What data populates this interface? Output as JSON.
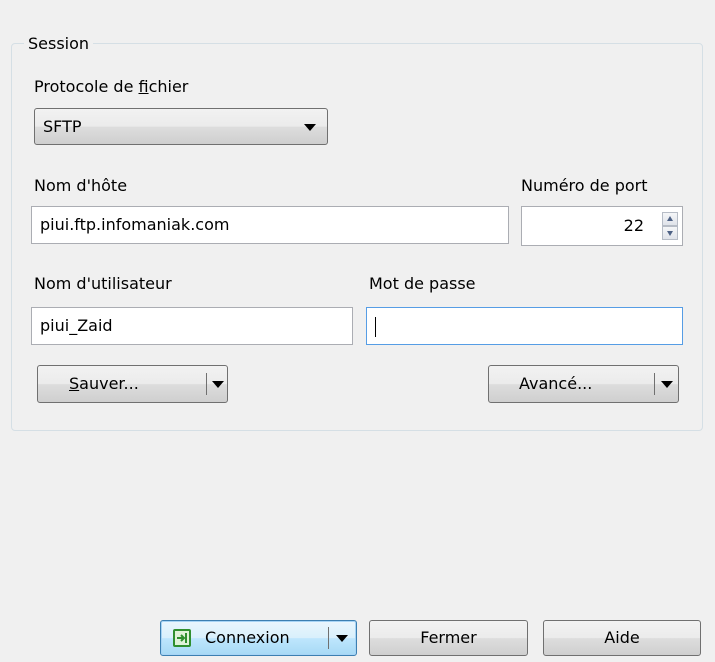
{
  "session": {
    "group_title": "Session",
    "protocol_label_pre": "Protocole de ",
    "protocol_label_accel": "f",
    "protocol_label_post": "ichier",
    "protocol_value": "SFTP",
    "host_label": "Nom d'hôte",
    "host_value": "piui.ftp.infomaniak.com",
    "port_label": "Numéro de port",
    "port_value": "22",
    "user_label": "Nom d'utilisateur",
    "user_value": "piui_Zaid",
    "password_label": "Mot de passe",
    "password_value": "",
    "save_accel": "S",
    "save_rest": "auver...",
    "advanced_label": "Avancé..."
  },
  "footer": {
    "connect_label": "Connexion",
    "close_label": "Fermer",
    "help_label": "Aide"
  },
  "icons": {
    "protocol_dropdown": "chevron-down-icon",
    "port_spinner": "spinner-arrows-icon",
    "connect": "login-arrow-icon"
  }
}
